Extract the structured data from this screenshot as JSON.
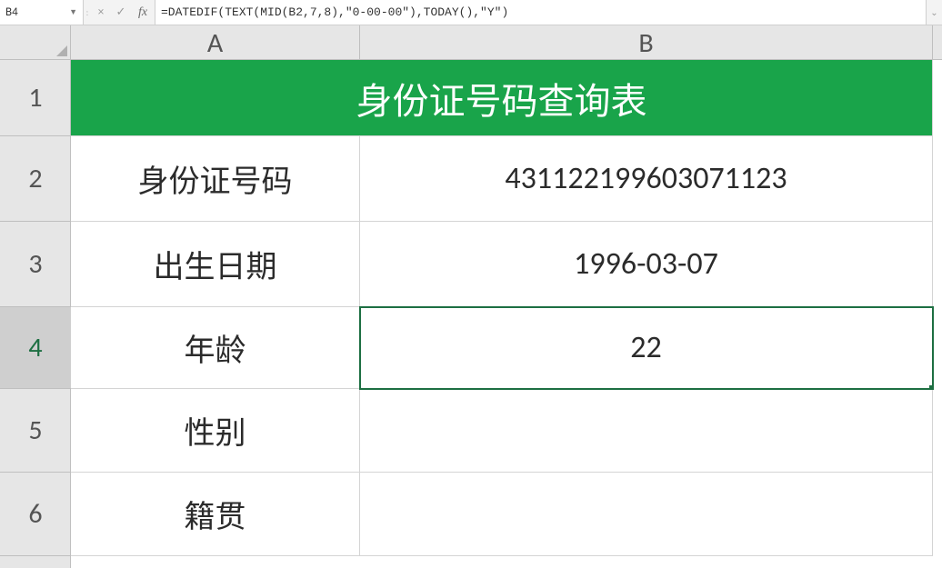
{
  "formula_bar": {
    "cell_ref": "B4",
    "cancel_icon": "×",
    "confirm_icon": "✓",
    "separator": ":",
    "fx_label": "fx",
    "formula": "=DATEDIF(TEXT(MID(B2,7,8),\"0-00-00\"),TODAY(),\"Y\")",
    "expand_icon": "⌄"
  },
  "columns": {
    "A": "A",
    "B": "B"
  },
  "rows": {
    "r1": "1",
    "r2": "2",
    "r3": "3",
    "r4": "4",
    "r5": "5",
    "r6": "6"
  },
  "sheet": {
    "title": "身份证号码查询表",
    "labels": {
      "id_number": "身份证号码",
      "birth_date": "出生日期",
      "age": "年龄",
      "gender": "性别",
      "native_place": "籍贯"
    },
    "values": {
      "id_number": "431122199603071123",
      "birth_date": "1996-03-07",
      "age": "22",
      "gender": "",
      "native_place": ""
    }
  },
  "active_cell": "B4"
}
